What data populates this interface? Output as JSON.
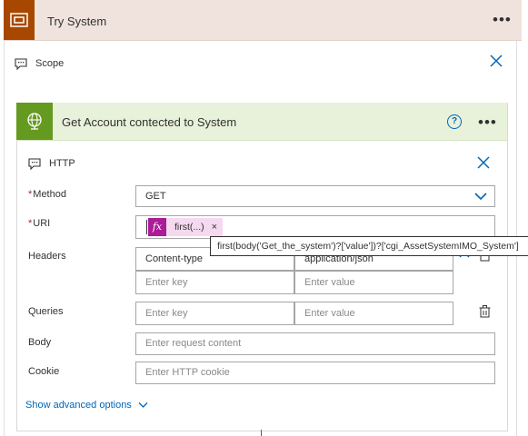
{
  "scope_card": {
    "title": "Try System",
    "more_label": "•••",
    "sub_label": "Scope",
    "close_label": "✕"
  },
  "action_card": {
    "title": "Get Account contected to System",
    "help_label": "?",
    "more_label": "•••",
    "sub_label": "HTTP",
    "close_label": "✕"
  },
  "form": {
    "method_label": "Method",
    "method_value": "GET",
    "uri_label": "URI",
    "uri_token_label": "first(...)",
    "uri_token_fx": "fx",
    "token_remove": "×",
    "headers_label": "Headers",
    "header_key_1": "Content-type",
    "header_value_1": "application/json",
    "header_key_placeholder": "Enter key",
    "header_value_placeholder": "Enter value",
    "queries_label": "Queries",
    "query_key_placeholder": "Enter key",
    "query_value_placeholder": "Enter value",
    "body_label": "Body",
    "body_placeholder": "Enter request content",
    "cookie_label": "Cookie",
    "cookie_placeholder": "Enter HTTP cookie",
    "required_mark": "*"
  },
  "tooltip": {
    "text": "first(body('Get_the_system')?['value'])?['cgi_AssetSystemIMO_System']"
  },
  "advanced": {
    "label": "Show advanced options"
  },
  "icons": {
    "scope": "scope-icon",
    "http": "globe-icon",
    "comment": "comment-icon",
    "delete": "trash-icon",
    "dropdown": "chevron-down-icon"
  },
  "colors": {
    "scope_brand": "#a84800",
    "scope_header_bg": "#f0e3dd",
    "http_brand": "#659a20",
    "http_header_bg": "#e8f1da",
    "accent": "#0066b8",
    "token_bg": "#f4d9ef",
    "token_fx_bg": "#ab1c98",
    "required": "#a4262c"
  }
}
